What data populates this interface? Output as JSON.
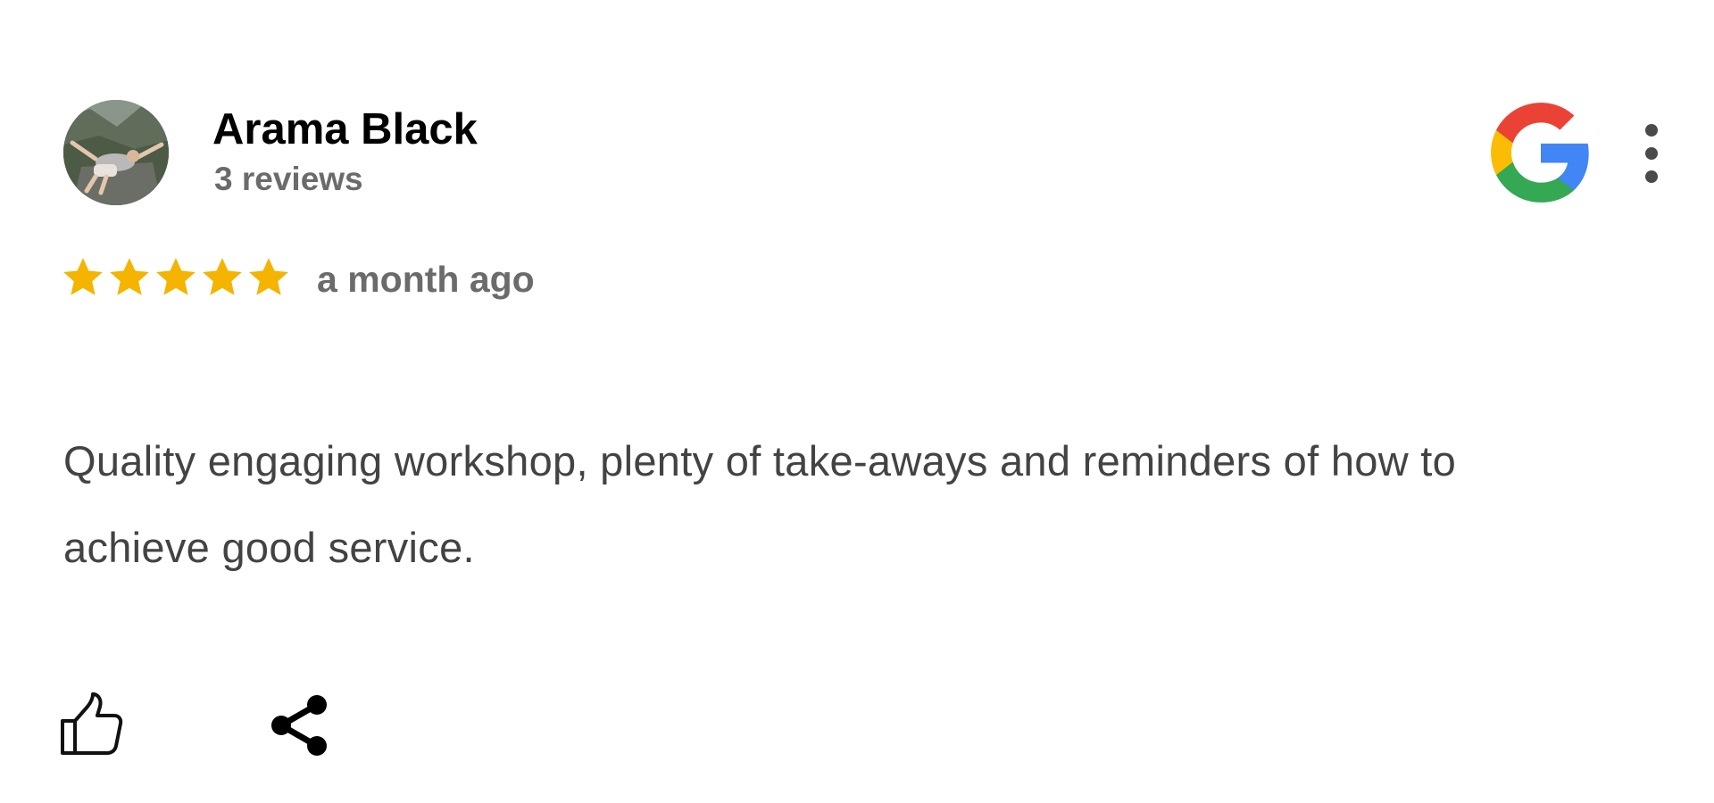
{
  "review": {
    "author": {
      "name": "Arama Black",
      "review_count": "3 reviews",
      "avatar_icon": "user-avatar-photo"
    },
    "source_icon": "google-logo-icon",
    "menu_icon": "more-vertical-icon",
    "rating": {
      "value": 5,
      "max": 5,
      "star_color": "#f4b400"
    },
    "time": "a month ago",
    "text": "Quality engaging workshop, plenty of take-aways and reminders of how to achieve good service.",
    "actions": {
      "like_icon": "thumbs-up-icon",
      "share_icon": "share-icon"
    }
  },
  "colors": {
    "name": "#000000",
    "meta": "#6b6b6b",
    "body": "#434343",
    "google_red": "#ea4335",
    "google_yellow": "#fbbc05",
    "google_green": "#34a853",
    "google_blue": "#4285f4"
  }
}
